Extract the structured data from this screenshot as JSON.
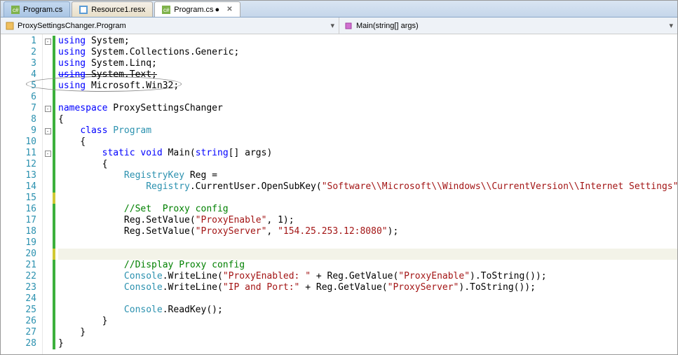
{
  "tabs": [
    {
      "label": "Program.cs",
      "active": false,
      "modified": false
    },
    {
      "label": "Resource1.resx",
      "active": false,
      "modified": false
    },
    {
      "label": "Program.cs",
      "active": true,
      "modified": true
    }
  ],
  "nav": {
    "left": "ProxySettingsChanger.Program",
    "right": "Main(string[] args)"
  },
  "code": {
    "lines": [
      {
        "n": 1,
        "fold": "minus",
        "change": "mod",
        "tokens": [
          [
            "kw",
            "using"
          ],
          [
            "plain",
            " System;"
          ]
        ]
      },
      {
        "n": 2,
        "change": "mod",
        "tokens": [
          [
            "kw",
            "using"
          ],
          [
            "plain",
            " System.Collections.Generic;"
          ]
        ]
      },
      {
        "n": 3,
        "change": "mod",
        "tokens": [
          [
            "kw",
            "using"
          ],
          [
            "plain",
            " System.Linq;"
          ]
        ]
      },
      {
        "n": 4,
        "change": "mod",
        "strike": true,
        "tokens": [
          [
            "kw",
            "using"
          ],
          [
            "plain",
            " System.Text;"
          ]
        ]
      },
      {
        "n": 5,
        "change": "mod",
        "tokens": [
          [
            "kw",
            "using"
          ],
          [
            "plain",
            " Microsoft.Win32;"
          ]
        ]
      },
      {
        "n": 6,
        "change": "mod",
        "tokens": []
      },
      {
        "n": 7,
        "fold": "minus",
        "change": "mod",
        "tokens": [
          [
            "kw",
            "namespace"
          ],
          [
            "plain",
            " ProxySettingsChanger"
          ]
        ]
      },
      {
        "n": 8,
        "change": "mod",
        "tokens": [
          [
            "plain",
            "{"
          ]
        ]
      },
      {
        "n": 9,
        "fold": "minus",
        "change": "mod",
        "tokens": [
          [
            "plain",
            "    "
          ],
          [
            "kw",
            "class"
          ],
          [
            "plain",
            " "
          ],
          [
            "type",
            "Program"
          ]
        ]
      },
      {
        "n": 10,
        "change": "mod",
        "tokens": [
          [
            "plain",
            "    {"
          ]
        ]
      },
      {
        "n": 11,
        "fold": "minus",
        "change": "mod",
        "tokens": [
          [
            "plain",
            "        "
          ],
          [
            "kw",
            "static"
          ],
          [
            "plain",
            " "
          ],
          [
            "kw",
            "void"
          ],
          [
            "plain",
            " Main("
          ],
          [
            "kw",
            "string"
          ],
          [
            "plain",
            "[] args)"
          ]
        ]
      },
      {
        "n": 12,
        "change": "mod",
        "tokens": [
          [
            "plain",
            "        {"
          ]
        ]
      },
      {
        "n": 13,
        "change": "mod",
        "tokens": [
          [
            "plain",
            "            "
          ],
          [
            "type",
            "RegistryKey"
          ],
          [
            "plain",
            " Reg ="
          ]
        ]
      },
      {
        "n": 14,
        "change": "mod",
        "tokens": [
          [
            "plain",
            "                "
          ],
          [
            "type",
            "Registry"
          ],
          [
            "plain",
            ".CurrentUser.OpenSubKey("
          ],
          [
            "str",
            "\"Software\\\\Microsoft\\\\Windows\\\\CurrentVersion\\\\Internet Settings\""
          ],
          [
            "plain",
            ", "
          ],
          [
            "kw",
            "true"
          ],
          [
            "plain",
            ");"
          ]
        ]
      },
      {
        "n": 15,
        "change": "edit",
        "tokens": []
      },
      {
        "n": 16,
        "change": "mod",
        "tokens": [
          [
            "plain",
            "            "
          ],
          [
            "cmt",
            "//Set  Proxy config"
          ]
        ]
      },
      {
        "n": 17,
        "change": "mod",
        "tokens": [
          [
            "plain",
            "            Reg.SetValue("
          ],
          [
            "str",
            "\"ProxyEnable\""
          ],
          [
            "plain",
            ", 1);"
          ]
        ]
      },
      {
        "n": 18,
        "change": "mod",
        "tokens": [
          [
            "plain",
            "            Reg.SetValue("
          ],
          [
            "str",
            "\"ProxyServer\""
          ],
          [
            "plain",
            ", "
          ],
          [
            "str",
            "\"154.25.253.12:8080\""
          ],
          [
            "plain",
            ");"
          ]
        ]
      },
      {
        "n": 19,
        "change": "mod",
        "tokens": []
      },
      {
        "n": 20,
        "change": "edit",
        "cursor": true,
        "tokens": []
      },
      {
        "n": 21,
        "change": "mod",
        "tokens": [
          [
            "plain",
            "            "
          ],
          [
            "cmt",
            "//Display Proxy config"
          ]
        ]
      },
      {
        "n": 22,
        "change": "mod",
        "tokens": [
          [
            "plain",
            "            "
          ],
          [
            "type",
            "Console"
          ],
          [
            "plain",
            ".WriteLine("
          ],
          [
            "str",
            "\"ProxyEnabled: \""
          ],
          [
            "plain",
            " + Reg.GetValue("
          ],
          [
            "str",
            "\"ProxyEnable\""
          ],
          [
            "plain",
            ").ToString());"
          ]
        ]
      },
      {
        "n": 23,
        "change": "mod",
        "tokens": [
          [
            "plain",
            "            "
          ],
          [
            "type",
            "Console"
          ],
          [
            "plain",
            ".WriteLine("
          ],
          [
            "str",
            "\"IP and Port:\""
          ],
          [
            "plain",
            " + Reg.GetValue("
          ],
          [
            "str",
            "\"ProxyServer\""
          ],
          [
            "plain",
            ").ToString());"
          ]
        ]
      },
      {
        "n": 24,
        "change": "mod",
        "tokens": []
      },
      {
        "n": 25,
        "change": "mod",
        "tokens": [
          [
            "plain",
            "            "
          ],
          [
            "type",
            "Console"
          ],
          [
            "plain",
            ".ReadKey();"
          ]
        ]
      },
      {
        "n": 26,
        "change": "mod",
        "tokens": [
          [
            "plain",
            "        }"
          ]
        ]
      },
      {
        "n": 27,
        "change": "mod",
        "tokens": [
          [
            "plain",
            "    }"
          ]
        ]
      },
      {
        "n": 28,
        "change": "mod",
        "tokens": [
          [
            "plain",
            "}"
          ]
        ]
      }
    ]
  }
}
